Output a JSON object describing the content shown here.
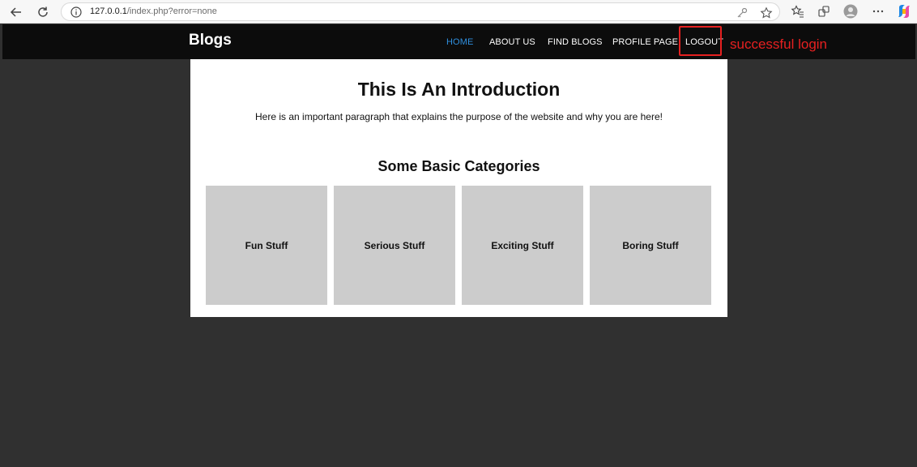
{
  "browser": {
    "url_host": "127.0.0.1",
    "url_path": "/index.php?error=none"
  },
  "site": {
    "logo": "Blogs",
    "nav": [
      {
        "label": "HOME",
        "active": true
      },
      {
        "label": "ABOUT US",
        "active": false
      },
      {
        "label": "FIND BLOGS",
        "active": false
      },
      {
        "label": "PROFILE PAGE",
        "active": false
      },
      {
        "label": "LOGOUT",
        "active": false
      }
    ],
    "annotation": "successful login"
  },
  "main": {
    "title": "This Is An Introduction",
    "paragraph": "Here is an important paragraph that explains the purpose of the website and why you are here!",
    "categories_title": "Some Basic Categories",
    "categories": [
      "Fun Stuff",
      "Serious Stuff",
      "Exciting Stuff",
      "Boring Stuff"
    ]
  },
  "colors": {
    "page_background": "#303030",
    "header_background": "#0c0c0c",
    "active_link": "#2f8fde",
    "annotation": "#e62020",
    "card_background": "#cccccc"
  }
}
